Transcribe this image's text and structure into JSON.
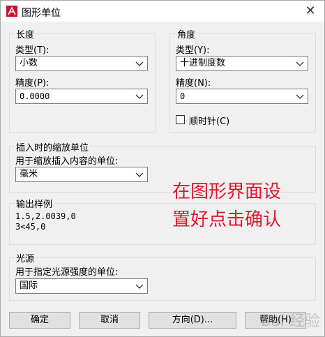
{
  "window": {
    "title": "图形单位",
    "close_glyph": "✕"
  },
  "length": {
    "group_label": "长度",
    "type_label": "类型(T):",
    "type_value": "小数",
    "precision_label": "精度(P):",
    "precision_value": "0.0000"
  },
  "angle": {
    "group_label": "角度",
    "type_label": "类型(Y):",
    "type_value": "十进制度数",
    "precision_label": "精度(N):",
    "precision_value": "0",
    "clockwise_label": "顺时针(C)",
    "clockwise_checked": false
  },
  "insert": {
    "group_label": "插入时的缩放单位",
    "units_label": "用于缩放插入内容的单位:",
    "units_value": "毫米"
  },
  "sample": {
    "group_label": "输出样例",
    "line1": "1.5,2.0039,0",
    "line2": "3<45,0"
  },
  "light": {
    "group_label": "光源",
    "units_label": "用于指定光源强度的单位:",
    "units_value": "国际"
  },
  "annotation": {
    "line1": "在图形界面设",
    "line2": "置好点击确认",
    "color": "#e0182c"
  },
  "buttons": {
    "ok": "确定",
    "cancel": "取消",
    "direction": "方向(D)...",
    "help": "帮助(H)"
  },
  "watermark": "Bai 经验"
}
